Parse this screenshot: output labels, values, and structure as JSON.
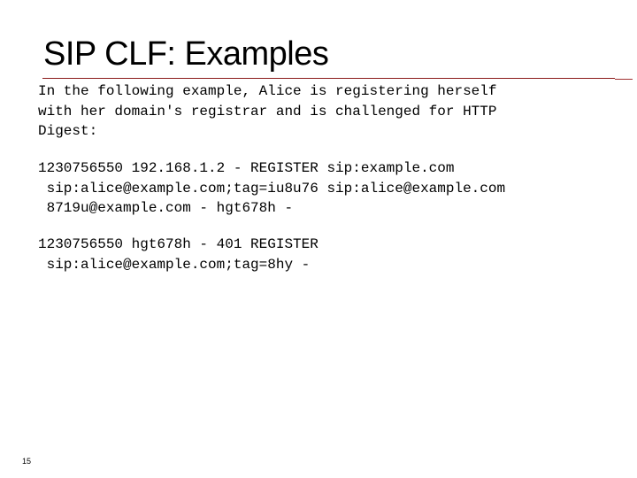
{
  "slide": {
    "title": "SIP CLF: Examples",
    "paragraphs": [
      {
        "lines": [
          "In the following example, Alice is registering herself",
          "with her domain's registrar and is challenged for HTTP",
          "Digest:"
        ]
      },
      {
        "lines": [
          "1230756550 192.168.1.2 - REGISTER sip:example.com",
          " sip:alice@example.com;tag=iu8u76 sip:alice@example.com",
          " 8719u@example.com - hgt678h -"
        ]
      },
      {
        "lines": [
          "1230756550 hgt678h - 401 REGISTER",
          " sip:alice@example.com;tag=8hy -"
        ]
      }
    ],
    "slide_number": "15",
    "accent_color": "#8b1a1a"
  }
}
